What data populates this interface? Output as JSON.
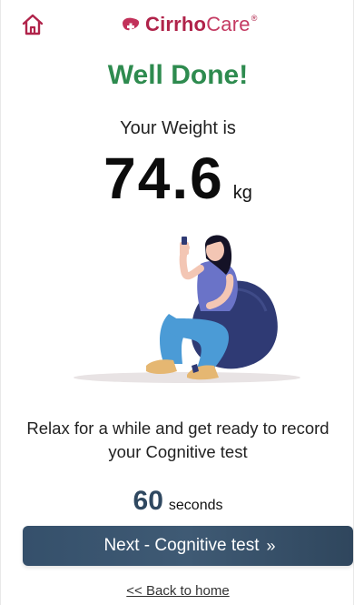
{
  "header": {
    "logo_bold": "CirrhoCare",
    "logo_bold_part": "Cirrho",
    "logo_light_part": "Care",
    "logo_mark": "®"
  },
  "title": "Well Done!",
  "weight": {
    "label": "Your Weight is",
    "value": "74.6",
    "unit": "kg"
  },
  "message": "Relax for a while and get ready to record your Cognitive test",
  "timer": {
    "value": "60",
    "unit": "seconds"
  },
  "next_button": {
    "label": "Next - Cognitive test",
    "chevrons": "»"
  },
  "back_link": "<< Back to home",
  "colors": {
    "brand": "#b0234a",
    "success": "#2e8b4f",
    "button": "#3a546e",
    "timer": "#2f4860"
  },
  "icons": {
    "home": "home-icon",
    "logo": "liver-logo-icon"
  }
}
